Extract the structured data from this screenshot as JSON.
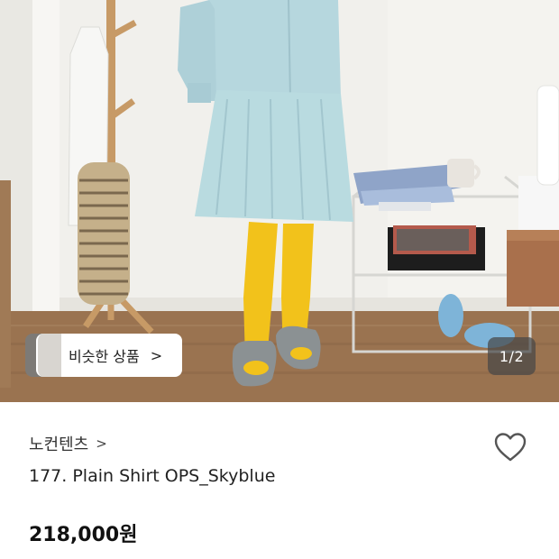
{
  "product_image": {
    "subject": "Model wearing sky blue shirt dress with yellow tights and grey slides",
    "counter": "1/2"
  },
  "similar_products": {
    "label": "비슷한 상품",
    "chevron": ">"
  },
  "brand": {
    "name": "노컨텐츠",
    "chevron": ">"
  },
  "wishlist": {
    "icon": "heart-outline-icon"
  },
  "product": {
    "title": "177. Plain Shirt OPS_Skyblue",
    "price": "218,000원"
  },
  "colors": {
    "dress": "#b9dbe0",
    "tights": "#f2c21b",
    "counter_bg": "#464646"
  }
}
